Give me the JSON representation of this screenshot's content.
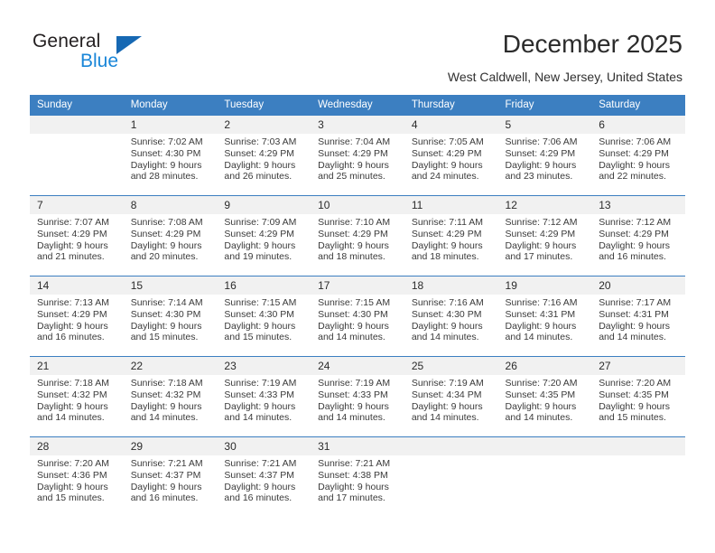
{
  "brand": {
    "name_part1": "General",
    "name_part2": "Blue",
    "accent_color": "#1668b3",
    "blue_text_color": "#1986d8"
  },
  "header": {
    "title": "December 2025",
    "subtitle": "West Caldwell, New Jersey, United States"
  },
  "calendar": {
    "header_bg": "#3c7fc1",
    "daynum_bg": "#f1f1f1",
    "weekday_headers": [
      "Sunday",
      "Monday",
      "Tuesday",
      "Wednesday",
      "Thursday",
      "Friday",
      "Saturday"
    ],
    "weeks": [
      [
        {
          "day": "",
          "info": ""
        },
        {
          "day": "1",
          "info": "Sunrise: 7:02 AM\nSunset: 4:30 PM\nDaylight: 9 hours\nand 28 minutes."
        },
        {
          "day": "2",
          "info": "Sunrise: 7:03 AM\nSunset: 4:29 PM\nDaylight: 9 hours\nand 26 minutes."
        },
        {
          "day": "3",
          "info": "Sunrise: 7:04 AM\nSunset: 4:29 PM\nDaylight: 9 hours\nand 25 minutes."
        },
        {
          "day": "4",
          "info": "Sunrise: 7:05 AM\nSunset: 4:29 PM\nDaylight: 9 hours\nand 24 minutes."
        },
        {
          "day": "5",
          "info": "Sunrise: 7:06 AM\nSunset: 4:29 PM\nDaylight: 9 hours\nand 23 minutes."
        },
        {
          "day": "6",
          "info": "Sunrise: 7:06 AM\nSunset: 4:29 PM\nDaylight: 9 hours\nand 22 minutes."
        }
      ],
      [
        {
          "day": "7",
          "info": "Sunrise: 7:07 AM\nSunset: 4:29 PM\nDaylight: 9 hours\nand 21 minutes."
        },
        {
          "day": "8",
          "info": "Sunrise: 7:08 AM\nSunset: 4:29 PM\nDaylight: 9 hours\nand 20 minutes."
        },
        {
          "day": "9",
          "info": "Sunrise: 7:09 AM\nSunset: 4:29 PM\nDaylight: 9 hours\nand 19 minutes."
        },
        {
          "day": "10",
          "info": "Sunrise: 7:10 AM\nSunset: 4:29 PM\nDaylight: 9 hours\nand 18 minutes."
        },
        {
          "day": "11",
          "info": "Sunrise: 7:11 AM\nSunset: 4:29 PM\nDaylight: 9 hours\nand 18 minutes."
        },
        {
          "day": "12",
          "info": "Sunrise: 7:12 AM\nSunset: 4:29 PM\nDaylight: 9 hours\nand 17 minutes."
        },
        {
          "day": "13",
          "info": "Sunrise: 7:12 AM\nSunset: 4:29 PM\nDaylight: 9 hours\nand 16 minutes."
        }
      ],
      [
        {
          "day": "14",
          "info": "Sunrise: 7:13 AM\nSunset: 4:29 PM\nDaylight: 9 hours\nand 16 minutes."
        },
        {
          "day": "15",
          "info": "Sunrise: 7:14 AM\nSunset: 4:30 PM\nDaylight: 9 hours\nand 15 minutes."
        },
        {
          "day": "16",
          "info": "Sunrise: 7:15 AM\nSunset: 4:30 PM\nDaylight: 9 hours\nand 15 minutes."
        },
        {
          "day": "17",
          "info": "Sunrise: 7:15 AM\nSunset: 4:30 PM\nDaylight: 9 hours\nand 14 minutes."
        },
        {
          "day": "18",
          "info": "Sunrise: 7:16 AM\nSunset: 4:30 PM\nDaylight: 9 hours\nand 14 minutes."
        },
        {
          "day": "19",
          "info": "Sunrise: 7:16 AM\nSunset: 4:31 PM\nDaylight: 9 hours\nand 14 minutes."
        },
        {
          "day": "20",
          "info": "Sunrise: 7:17 AM\nSunset: 4:31 PM\nDaylight: 9 hours\nand 14 minutes."
        }
      ],
      [
        {
          "day": "21",
          "info": "Sunrise: 7:18 AM\nSunset: 4:32 PM\nDaylight: 9 hours\nand 14 minutes."
        },
        {
          "day": "22",
          "info": "Sunrise: 7:18 AM\nSunset: 4:32 PM\nDaylight: 9 hours\nand 14 minutes."
        },
        {
          "day": "23",
          "info": "Sunrise: 7:19 AM\nSunset: 4:33 PM\nDaylight: 9 hours\nand 14 minutes."
        },
        {
          "day": "24",
          "info": "Sunrise: 7:19 AM\nSunset: 4:33 PM\nDaylight: 9 hours\nand 14 minutes."
        },
        {
          "day": "25",
          "info": "Sunrise: 7:19 AM\nSunset: 4:34 PM\nDaylight: 9 hours\nand 14 minutes."
        },
        {
          "day": "26",
          "info": "Sunrise: 7:20 AM\nSunset: 4:35 PM\nDaylight: 9 hours\nand 14 minutes."
        },
        {
          "day": "27",
          "info": "Sunrise: 7:20 AM\nSunset: 4:35 PM\nDaylight: 9 hours\nand 15 minutes."
        }
      ],
      [
        {
          "day": "28",
          "info": "Sunrise: 7:20 AM\nSunset: 4:36 PM\nDaylight: 9 hours\nand 15 minutes."
        },
        {
          "day": "29",
          "info": "Sunrise: 7:21 AM\nSunset: 4:37 PM\nDaylight: 9 hours\nand 16 minutes."
        },
        {
          "day": "30",
          "info": "Sunrise: 7:21 AM\nSunset: 4:37 PM\nDaylight: 9 hours\nand 16 minutes."
        },
        {
          "day": "31",
          "info": "Sunrise: 7:21 AM\nSunset: 4:38 PM\nDaylight: 9 hours\nand 17 minutes."
        },
        {
          "day": "",
          "info": ""
        },
        {
          "day": "",
          "info": ""
        },
        {
          "day": "",
          "info": ""
        }
      ]
    ]
  }
}
